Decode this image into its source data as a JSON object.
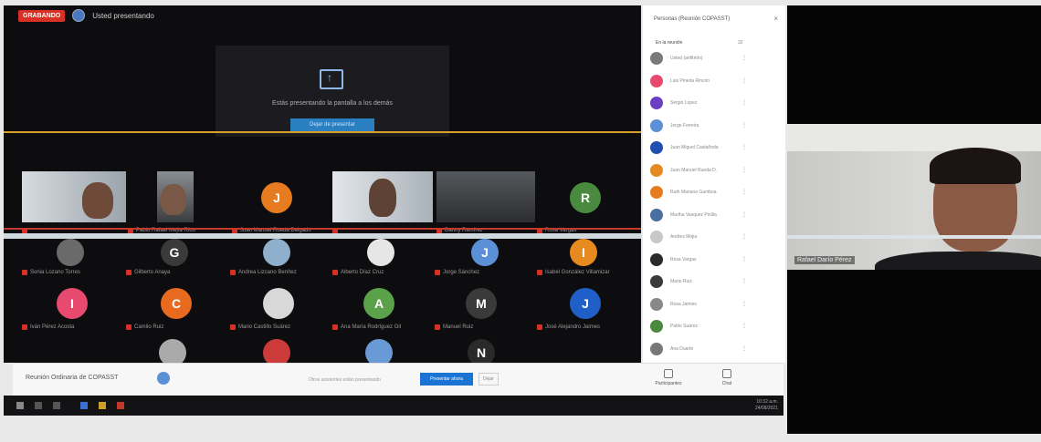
{
  "topbar": {
    "rec_label": "GRABANDO",
    "meeting_title": "Usted presentando"
  },
  "share": {
    "message": "Estás presentando la pantalla a los demás",
    "button_label": "Dejar de presentar"
  },
  "row1_tiles": [
    {
      "name": "",
      "type": "video"
    },
    {
      "name": "Pablo Rafael Mejía Ríos",
      "type": "video"
    },
    {
      "name": "Juan Manuel Rueda Delgado",
      "type": "avatar",
      "letter": "J",
      "color": "#e67c1f"
    },
    {
      "name": "",
      "type": "video"
    },
    {
      "name": "Danny Ramírez",
      "type": "video"
    },
    {
      "name": "Rosa Vargas",
      "type": "avatar",
      "letter": "R",
      "color": "#4a8a3e"
    }
  ],
  "row2_tiles": [
    {
      "name": "Sonia Lozano Torres",
      "type": "photo",
      "color": "#6a6a6a"
    },
    {
      "name": "Gilberto Anaya",
      "type": "avatar",
      "letter": "G",
      "color": "#3a3a3a"
    },
    {
      "name": "Andrea Lizcano Benítez",
      "type": "photo",
      "color": "#8fb0cc"
    },
    {
      "name": "Alberto Díaz Cruz",
      "type": "photo",
      "color": "#e0e0e0"
    },
    {
      "name": "Jorge Sánchez",
      "type": "avatar",
      "letter": "J",
      "color": "#5b8fd6"
    },
    {
      "name": "Isabel González Villamizar",
      "type": "avatar",
      "letter": "I",
      "color": "#e68a1f"
    }
  ],
  "row3_tiles": [
    {
      "name": "Iván Pérez Acosta",
      "type": "avatar",
      "letter": "I",
      "color": "#e84a6f"
    },
    {
      "name": "Camilo Ruiz",
      "type": "avatar",
      "letter": "C",
      "color": "#e86a1f"
    },
    {
      "name": "Mario Castillo Suárez",
      "type": "photo",
      "color": "#d8d8d8"
    },
    {
      "name": "Ana María Rodríguez Gil",
      "type": "avatar",
      "letter": "A",
      "color": "#5aa14a"
    },
    {
      "name": "Manuel Ruiz",
      "type": "avatar",
      "letter": "M",
      "color": "#3a3a3a"
    },
    {
      "name": "José Alejandro Jaimes",
      "type": "avatar",
      "letter": "J",
      "color": "#1f5fc7"
    }
  ],
  "row4_tiles": [
    {
      "type": "photo",
      "color": "#aaaaaa"
    },
    {
      "type": "photo",
      "color": "#cc3a3a"
    },
    {
      "type": "photo",
      "color": "#6a9ad6"
    },
    {
      "type": "avatar",
      "letter": "N",
      "color": "#2a2a2a"
    }
  ],
  "bottombar": {
    "meeting_name": "Reunión Ordinaria de COPASST",
    "notice": "Otros asistentes están presentando",
    "present_label": "Presentar ahora",
    "stop_label": "Dejar",
    "participants_label": "Participantes",
    "chat_label": "Chat"
  },
  "taskbar": {
    "time": "10:32 a.m.",
    "date": "24/08/2021"
  },
  "panel": {
    "title": "Personas (Reunión COPASST)",
    "close": "×",
    "section_label": "En la reunión",
    "count": "32",
    "participants": [
      {
        "name": "Usted (anfitrión)",
        "color": "#7a7a7a"
      },
      {
        "name": "Luis Pineda Rincón",
        "color": "#e84a6f"
      },
      {
        "name": "Sergio Lopez",
        "color": "#6a3fc2"
      },
      {
        "name": "Jorge Ferreira",
        "color": "#5b8fd6"
      },
      {
        "name": "Juan Miguel Castañeda",
        "color": "#1f4fb0"
      },
      {
        "name": "Juan Manuel Rueda D.",
        "color": "#e68a1f"
      },
      {
        "name": "Ruth Mariana Gamboa",
        "color": "#e67c1f"
      },
      {
        "name": "Martha Vasquez Pinilla",
        "color": "#4a6fa0"
      },
      {
        "name": "Andres Mejia",
        "color": "#c8c8c8"
      },
      {
        "name": "Rosa Vargas",
        "color": "#2a2a2a"
      },
      {
        "name": "Mario Ruiz",
        "color": "#3a3a3a"
      },
      {
        "name": "Rosa Jaimes",
        "color": "#888888"
      },
      {
        "name": "Pablo Suárez",
        "color": "#4a8a3e"
      },
      {
        "name": "Ana Duarte",
        "color": "#777777"
      }
    ]
  },
  "webcam": {
    "name": "Rafael Darío Pérez"
  }
}
